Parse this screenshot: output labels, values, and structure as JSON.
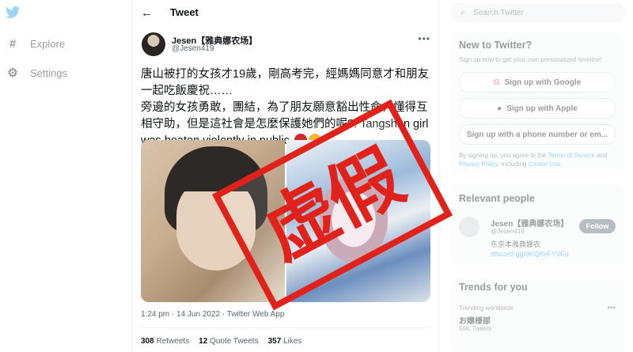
{
  "nav": {
    "items": [
      {
        "label": "Explore",
        "icon": "hashtag-icon"
      },
      {
        "label": "Settings",
        "icon": "gear-icon"
      }
    ]
  },
  "header": {
    "title": "Tweet"
  },
  "tweet": {
    "name": "Jesen【雅典娜农场】",
    "handle": "@Jesen419",
    "text": "唐山被打的女孩才19歲，剛高考完，經媽媽同意才和朋友一起吃飯慶祝……\n旁邊的女孩勇敢，團結，為了朋友願意豁出性命，懂得互相守助，但是這社會是怎麼保護她們的呢?! Tangshan girl was beaten violently in public",
    "time": "1:24 pm · 14 Jun 2022 · Twitter Web App",
    "retweets": "308",
    "retweets_label": "Retweets",
    "quotes": "12",
    "quotes_label": "Quote Tweets",
    "likes": "357",
    "likes_label": "Likes"
  },
  "stamp": {
    "text": "虚假",
    "color": "#e0221b"
  },
  "search": {
    "placeholder": "Search Twitter"
  },
  "new_to_twitter": {
    "title": "New to Twitter?",
    "subtitle": "Sign up now to get your own personalized timeline!",
    "google": "Sign up with Google",
    "apple": "Sign up with Apple",
    "phone": "Sign up with a phone number or em...",
    "terms_prefix": "By signing up, you agree to the",
    "terms_link": "Terms of Service",
    "and": "and",
    "privacy_link": "Privacy Policy",
    "cookie_prefix": ", including",
    "cookie_link": "Cookie Use."
  },
  "relevant": {
    "title": "Relevant people",
    "name": "Jesen【雅典娜农场】",
    "handle": "@Jesen419",
    "bio": "东京本雅典娜农",
    "link": "discord.gg/dKQ6vFY9Fu",
    "follow": "Follow"
  },
  "trends": {
    "title": "Trends for you",
    "context": "Trending worldwide",
    "topic": "お嬢様部",
    "count": "59K Tweets"
  },
  "colors": {
    "accent": "#1d9bf0",
    "stamp": "#e0221b"
  }
}
